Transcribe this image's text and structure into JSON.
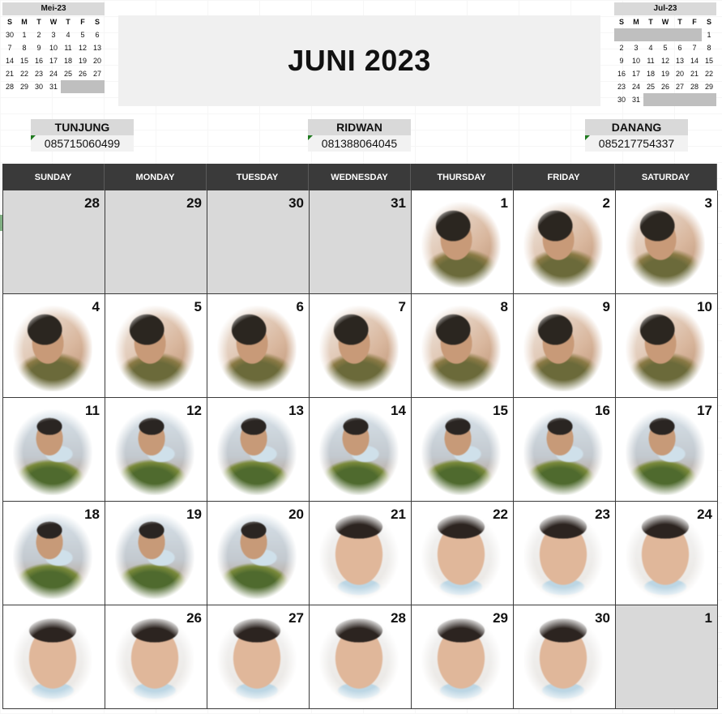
{
  "title": "JUNI 2023",
  "prev_month": {
    "title": "Mei-23",
    "weekdays": [
      "S",
      "M",
      "T",
      "W",
      "T",
      "F",
      "S"
    ],
    "weeks": [
      [
        "30",
        "1",
        "2",
        "3",
        "4",
        "5",
        "6"
      ],
      [
        "7",
        "8",
        "9",
        "10",
        "11",
        "12",
        "13"
      ],
      [
        "14",
        "15",
        "16",
        "17",
        "18",
        "19",
        "20"
      ],
      [
        "21",
        "22",
        "23",
        "24",
        "25",
        "26",
        "27"
      ],
      [
        "28",
        "29",
        "30",
        "31",
        "",
        "",
        ""
      ]
    ]
  },
  "next_month": {
    "title": "Jul-23",
    "weekdays": [
      "S",
      "M",
      "T",
      "W",
      "T",
      "F",
      "S"
    ],
    "weeks": [
      [
        "",
        "",
        "",
        "",
        "",
        "",
        "1"
      ],
      [
        "2",
        "3",
        "4",
        "5",
        "6",
        "7",
        "8"
      ],
      [
        "9",
        "10",
        "11",
        "12",
        "13",
        "14",
        "15"
      ],
      [
        "16",
        "17",
        "18",
        "19",
        "20",
        "21",
        "22"
      ],
      [
        "23",
        "24",
        "25",
        "26",
        "27",
        "28",
        "29"
      ],
      [
        "30",
        "31",
        "",
        "",
        "",
        "",
        ""
      ]
    ]
  },
  "contacts": [
    {
      "name": "TUNJUNG",
      "phone": "085715060499"
    },
    {
      "name": "RIDWAN",
      "phone": "081388064045"
    },
    {
      "name": "DANANG",
      "phone": "085217754337"
    }
  ],
  "weekdays": [
    "SUNDAY",
    "MONDAY",
    "TUESDAY",
    "WEDNESDAY",
    "THURSDAY",
    "FRIDAY",
    "SATURDAY"
  ],
  "days": [
    {
      "day": "28",
      "other": true,
      "photo": ""
    },
    {
      "day": "29",
      "other": true,
      "photo": ""
    },
    {
      "day": "30",
      "other": true,
      "photo": ""
    },
    {
      "day": "31",
      "other": true,
      "photo": ""
    },
    {
      "day": "1",
      "other": false,
      "photo": "tunjung"
    },
    {
      "day": "2",
      "other": false,
      "photo": "tunjung"
    },
    {
      "day": "3",
      "other": false,
      "photo": "tunjung"
    },
    {
      "day": "4",
      "other": false,
      "photo": "tunjung"
    },
    {
      "day": "5",
      "other": false,
      "photo": "tunjung"
    },
    {
      "day": "6",
      "other": false,
      "photo": "tunjung"
    },
    {
      "day": "7",
      "other": false,
      "photo": "tunjung"
    },
    {
      "day": "8",
      "other": false,
      "photo": "tunjung"
    },
    {
      "day": "9",
      "other": false,
      "photo": "tunjung"
    },
    {
      "day": "10",
      "other": false,
      "photo": "tunjung"
    },
    {
      "day": "11",
      "other": false,
      "photo": "ridwan"
    },
    {
      "day": "12",
      "other": false,
      "photo": "ridwan"
    },
    {
      "day": "13",
      "other": false,
      "photo": "ridwan"
    },
    {
      "day": "14",
      "other": false,
      "photo": "ridwan"
    },
    {
      "day": "15",
      "other": false,
      "photo": "ridwan"
    },
    {
      "day": "16",
      "other": false,
      "photo": "ridwan"
    },
    {
      "day": "17",
      "other": false,
      "photo": "ridwan"
    },
    {
      "day": "18",
      "other": false,
      "photo": "ridwan"
    },
    {
      "day": "19",
      "other": false,
      "photo": "ridwan"
    },
    {
      "day": "20",
      "other": false,
      "photo": "ridwan"
    },
    {
      "day": "21",
      "other": false,
      "photo": "danang"
    },
    {
      "day": "22",
      "other": false,
      "photo": "danang"
    },
    {
      "day": "23",
      "other": false,
      "photo": "danang"
    },
    {
      "day": "24",
      "other": false,
      "photo": "danang"
    },
    {
      "day": "",
      "other": false,
      "photo": "danang"
    },
    {
      "day": "26",
      "other": false,
      "photo": "danang"
    },
    {
      "day": "27",
      "other": false,
      "photo": "danang"
    },
    {
      "day": "28",
      "other": false,
      "photo": "danang"
    },
    {
      "day": "29",
      "other": false,
      "photo": "danang"
    },
    {
      "day": "30",
      "other": false,
      "photo": "danang"
    },
    {
      "day": "1",
      "other": true,
      "photo": ""
    }
  ],
  "colors": {
    "header_bg": "#3a3a3a",
    "other_month_bg": "#d9d9d9",
    "title_bg": "#f0f0f0",
    "contact_name_bg": "#d9d9d9",
    "comment_marker": "#1f7a1f"
  }
}
